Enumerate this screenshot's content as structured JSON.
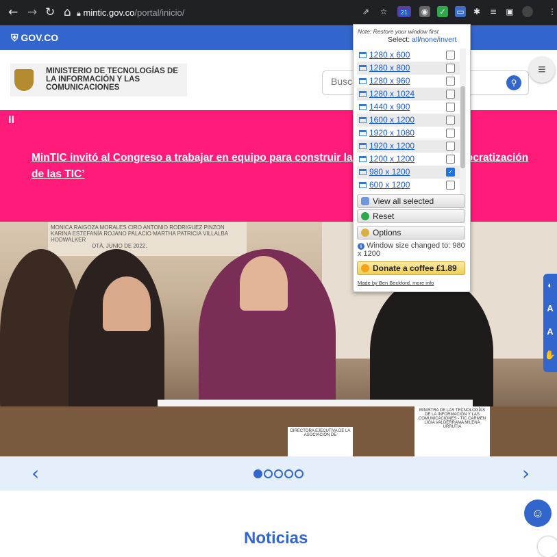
{
  "browser": {
    "url_host": "mintic.gov.co",
    "url_path": "/portal/inicio/",
    "ext_badge": "21"
  },
  "govbar": {
    "logo": "GOV.CO"
  },
  "header": {
    "ministry_name": "MINISTERIO DE TECNOLOGÍAS DE LA INFORMACIÓN Y LAS COMUNICACIONES",
    "search_placeholder": "Buscar"
  },
  "banner": {
    "headline": "MinTIC invitó al Congreso a trabajar en equipo para construir la ley que busca la ‘Democratización de las TIC’",
    "pause_label": "II"
  },
  "photo": {
    "plaque_line1": "MONICA RAIGOZA MORALES   CIRO ANTONIO RODRIGUEZ PINZON",
    "plaque_line2": "KARINA ESTEFANÍA ROJANO PALACIO   MARTHA PATRICIA VILLALBA HODWALKER",
    "plaque_line3": "OTÁ, JUNIO DE 2022.",
    "sign_left": "DIRECTORA EJECUTIVA DE LA ASOCIACIÓN DE",
    "sign_right": "MINISTRA DE LAS TECNOLOGÍAS DE LA INFORMACIÓN Y LAS COMUNICACIONES - TIC CARMEN LIGIA VALDERRAMA MILENA URRUTIA"
  },
  "carousel": {
    "prev": "‹",
    "next": "›"
  },
  "section": {
    "title": "Noticias"
  },
  "popup": {
    "note": "Note: Restore your window first",
    "select_label": "Select:",
    "select_all": "all",
    "select_none": "none",
    "select_invert": "invert",
    "sizes": [
      {
        "label": "1280 x 600",
        "checked": false
      },
      {
        "label": "1280 x 800",
        "checked": false
      },
      {
        "label": "1280 x 960",
        "checked": false
      },
      {
        "label": "1280 x 1024",
        "checked": false
      },
      {
        "label": "1440 x 900",
        "checked": false
      },
      {
        "label": "1600 x 1200",
        "checked": false
      },
      {
        "label": "1920 x 1080",
        "checked": false
      },
      {
        "label": "1920 x 1200",
        "checked": false
      },
      {
        "label": "1200 x 1200",
        "checked": false
      },
      {
        "label": "980 x 1200",
        "checked": true
      },
      {
        "label": "600 x 1200",
        "checked": false
      }
    ],
    "view_all": "View all selected",
    "reset": "Reset",
    "options": "Options",
    "status": "Window size changed to: 980 x 1200",
    "donate": "Donate a coffee £1.89",
    "made_by": "Made by Ben Beckford",
    "more_info": "more info"
  },
  "a11y": [
    "◐",
    "A",
    "A",
    "✋"
  ],
  "colors": {
    "gov_blue": "#3366cc",
    "banner_pink": "#ff1b7a"
  }
}
